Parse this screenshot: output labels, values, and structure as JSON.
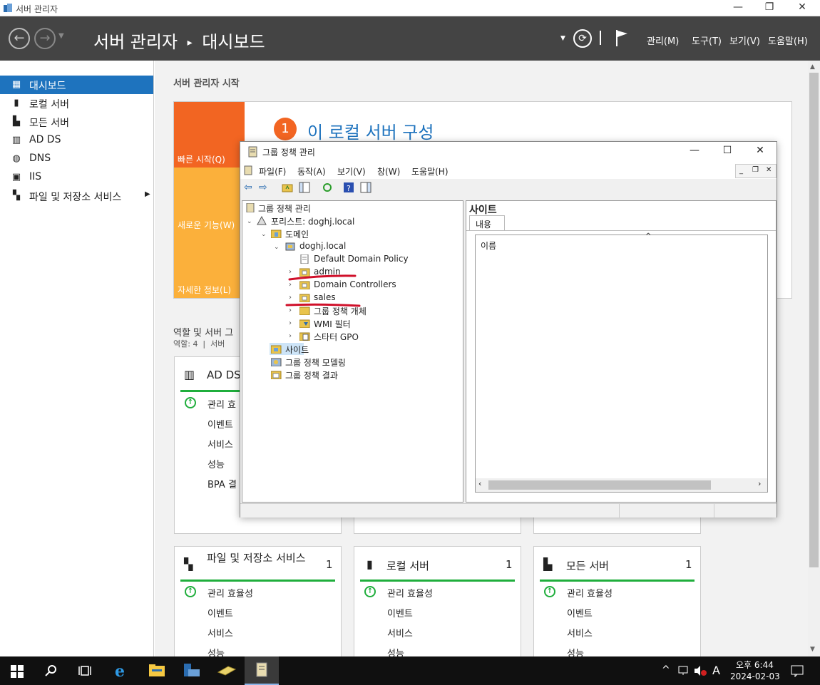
{
  "window": {
    "title": "서버 관리자",
    "minimize": "—",
    "restore": "❐",
    "close": "✕"
  },
  "header": {
    "breadcrumb_root": "서버 관리자",
    "breadcrumb_sep": "▸",
    "breadcrumb_page": "대시보드",
    "menus": [
      "관리(M)",
      "도구(T)",
      "보기(V)",
      "도움말(H)"
    ]
  },
  "sidebar": {
    "items": [
      {
        "label": "대시보드",
        "icon": "dashboard-icon"
      },
      {
        "label": "로컬 서버",
        "icon": "server-icon"
      },
      {
        "label": "모든 서버",
        "icon": "servers-icon"
      },
      {
        "label": "AD DS",
        "icon": "ad-ds-icon"
      },
      {
        "label": "DNS",
        "icon": "dns-icon"
      },
      {
        "label": "IIS",
        "icon": "iis-icon"
      },
      {
        "label": "파일 및 저장소 서비스",
        "icon": "storage-icon"
      }
    ]
  },
  "welcome": {
    "title": "서버 관리자 시작",
    "quick_start": "빠른 시작(Q)",
    "whats_new": "새로운 기능(W)",
    "learn_more": "자세한 정보(L)",
    "step_num": "1",
    "step_text": "이 로컬 서버 구성"
  },
  "roles": {
    "title": "역할 및 서버 그",
    "subtitle": "역할: 4  |  서버"
  },
  "tiles": [
    {
      "title": "AD DS",
      "count": "",
      "items": [
        "관리 효",
        "이벤트",
        "서비스",
        "성능",
        "BPA 결"
      ]
    },
    {
      "title": "파일 및 저장소 서비스",
      "count": "1",
      "items": [
        "관리 효율성",
        "이벤트",
        "서비스",
        "성능"
      ]
    },
    {
      "title": "로컬 서버",
      "count": "1",
      "items": [
        "관리 효율성",
        "이벤트",
        "서비스",
        "성능"
      ]
    },
    {
      "title": "모든 서버",
      "count": "1",
      "items": [
        "관리 효율성",
        "이벤트",
        "서비스",
        "성능"
      ]
    }
  ],
  "gpm": {
    "title": "그룹 정책 관리",
    "menus": [
      "파일(F)",
      "동작(A)",
      "보기(V)",
      "창(W)",
      "도움말(H)"
    ],
    "tree": [
      "그룹 정책 관리",
      "포리스트: doghj.local",
      "도메인",
      "doghj.local",
      "Default Domain Policy",
      "admin",
      "Domain Controllers",
      "sales",
      "그룹 정책 개체",
      "WMI 필터",
      "스타터 GPO",
      "사이트",
      "그룹 정책 모델링",
      "그룹 정책 결과"
    ],
    "right_title": "사이트",
    "tab": "내용",
    "col_header": "이름"
  },
  "taskbar": {
    "time": "오후 6:44",
    "date": "2024-02-03",
    "ime": "A"
  },
  "colors": {
    "accent": "#1e73be",
    "quick_start": "#f26522",
    "orange": "#fbb03b",
    "green": "#1fae3c",
    "annotation": "#d0102a"
  }
}
